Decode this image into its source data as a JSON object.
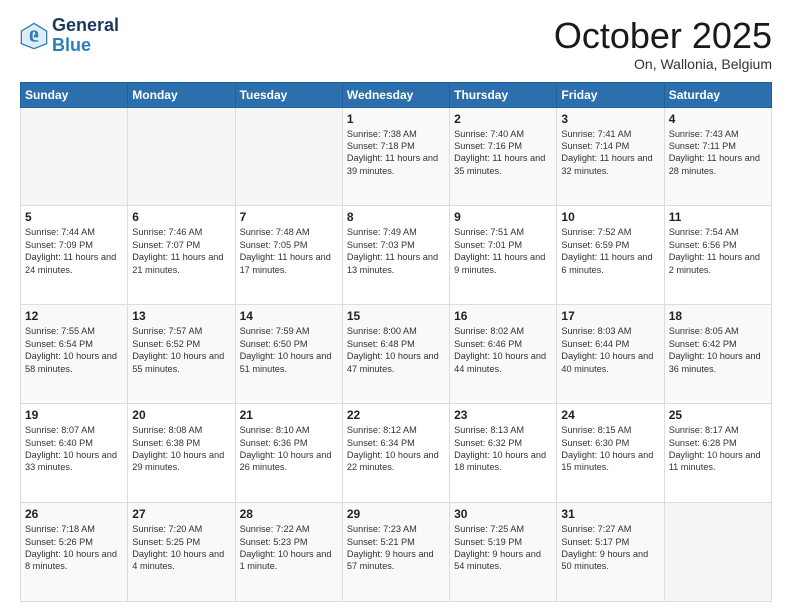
{
  "header": {
    "logo_line1": "General",
    "logo_line2": "Blue",
    "title": "October 2025",
    "subtitle": "On, Wallonia, Belgium"
  },
  "calendar": {
    "days_of_week": [
      "Sunday",
      "Monday",
      "Tuesday",
      "Wednesday",
      "Thursday",
      "Friday",
      "Saturday"
    ],
    "weeks": [
      [
        {
          "day": "",
          "text": ""
        },
        {
          "day": "",
          "text": ""
        },
        {
          "day": "",
          "text": ""
        },
        {
          "day": "1",
          "text": "Sunrise: 7:38 AM\nSunset: 7:18 PM\nDaylight: 11 hours\nand 39 minutes."
        },
        {
          "day": "2",
          "text": "Sunrise: 7:40 AM\nSunset: 7:16 PM\nDaylight: 11 hours\nand 35 minutes."
        },
        {
          "day": "3",
          "text": "Sunrise: 7:41 AM\nSunset: 7:14 PM\nDaylight: 11 hours\nand 32 minutes."
        },
        {
          "day": "4",
          "text": "Sunrise: 7:43 AM\nSunset: 7:11 PM\nDaylight: 11 hours\nand 28 minutes."
        }
      ],
      [
        {
          "day": "5",
          "text": "Sunrise: 7:44 AM\nSunset: 7:09 PM\nDaylight: 11 hours\nand 24 minutes."
        },
        {
          "day": "6",
          "text": "Sunrise: 7:46 AM\nSunset: 7:07 PM\nDaylight: 11 hours\nand 21 minutes."
        },
        {
          "day": "7",
          "text": "Sunrise: 7:48 AM\nSunset: 7:05 PM\nDaylight: 11 hours\nand 17 minutes."
        },
        {
          "day": "8",
          "text": "Sunrise: 7:49 AM\nSunset: 7:03 PM\nDaylight: 11 hours\nand 13 minutes."
        },
        {
          "day": "9",
          "text": "Sunrise: 7:51 AM\nSunset: 7:01 PM\nDaylight: 11 hours\nand 9 minutes."
        },
        {
          "day": "10",
          "text": "Sunrise: 7:52 AM\nSunset: 6:59 PM\nDaylight: 11 hours\nand 6 minutes."
        },
        {
          "day": "11",
          "text": "Sunrise: 7:54 AM\nSunset: 6:56 PM\nDaylight: 11 hours\nand 2 minutes."
        }
      ],
      [
        {
          "day": "12",
          "text": "Sunrise: 7:55 AM\nSunset: 6:54 PM\nDaylight: 10 hours\nand 58 minutes."
        },
        {
          "day": "13",
          "text": "Sunrise: 7:57 AM\nSunset: 6:52 PM\nDaylight: 10 hours\nand 55 minutes."
        },
        {
          "day": "14",
          "text": "Sunrise: 7:59 AM\nSunset: 6:50 PM\nDaylight: 10 hours\nand 51 minutes."
        },
        {
          "day": "15",
          "text": "Sunrise: 8:00 AM\nSunset: 6:48 PM\nDaylight: 10 hours\nand 47 minutes."
        },
        {
          "day": "16",
          "text": "Sunrise: 8:02 AM\nSunset: 6:46 PM\nDaylight: 10 hours\nand 44 minutes."
        },
        {
          "day": "17",
          "text": "Sunrise: 8:03 AM\nSunset: 6:44 PM\nDaylight: 10 hours\nand 40 minutes."
        },
        {
          "day": "18",
          "text": "Sunrise: 8:05 AM\nSunset: 6:42 PM\nDaylight: 10 hours\nand 36 minutes."
        }
      ],
      [
        {
          "day": "19",
          "text": "Sunrise: 8:07 AM\nSunset: 6:40 PM\nDaylight: 10 hours\nand 33 minutes."
        },
        {
          "day": "20",
          "text": "Sunrise: 8:08 AM\nSunset: 6:38 PM\nDaylight: 10 hours\nand 29 minutes."
        },
        {
          "day": "21",
          "text": "Sunrise: 8:10 AM\nSunset: 6:36 PM\nDaylight: 10 hours\nand 26 minutes."
        },
        {
          "day": "22",
          "text": "Sunrise: 8:12 AM\nSunset: 6:34 PM\nDaylight: 10 hours\nand 22 minutes."
        },
        {
          "day": "23",
          "text": "Sunrise: 8:13 AM\nSunset: 6:32 PM\nDaylight: 10 hours\nand 18 minutes."
        },
        {
          "day": "24",
          "text": "Sunrise: 8:15 AM\nSunset: 6:30 PM\nDaylight: 10 hours\nand 15 minutes."
        },
        {
          "day": "25",
          "text": "Sunrise: 8:17 AM\nSunset: 6:28 PM\nDaylight: 10 hours\nand 11 minutes."
        }
      ],
      [
        {
          "day": "26",
          "text": "Sunrise: 7:18 AM\nSunset: 5:26 PM\nDaylight: 10 hours\nand 8 minutes."
        },
        {
          "day": "27",
          "text": "Sunrise: 7:20 AM\nSunset: 5:25 PM\nDaylight: 10 hours\nand 4 minutes."
        },
        {
          "day": "28",
          "text": "Sunrise: 7:22 AM\nSunset: 5:23 PM\nDaylight: 10 hours\nand 1 minute."
        },
        {
          "day": "29",
          "text": "Sunrise: 7:23 AM\nSunset: 5:21 PM\nDaylight: 9 hours\nand 57 minutes."
        },
        {
          "day": "30",
          "text": "Sunrise: 7:25 AM\nSunset: 5:19 PM\nDaylight: 9 hours\nand 54 minutes."
        },
        {
          "day": "31",
          "text": "Sunrise: 7:27 AM\nSunset: 5:17 PM\nDaylight: 9 hours\nand 50 minutes."
        },
        {
          "day": "",
          "text": ""
        }
      ]
    ]
  }
}
